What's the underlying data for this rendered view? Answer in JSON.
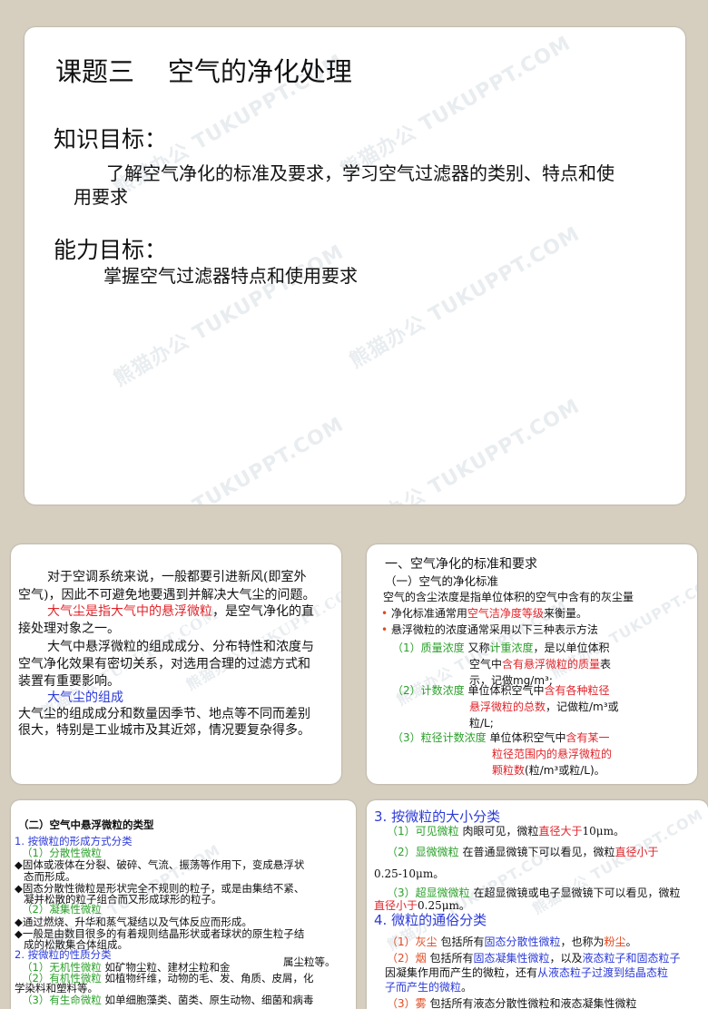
{
  "s1": {
    "title": "课题三    空气的净化处理",
    "knowledge_heading": "知识目标：",
    "knowledge_line1": "了解空气净化的标准及要求，学习空气过滤器的类别、特点和使",
    "knowledge_line2": "用要求",
    "ability_heading": "能力目标：",
    "ability_text": "掌握空气过滤器特点和使用要求"
  },
  "watermark": "熊猫办公 TUKUPPT.COM",
  "s2": {
    "l1": "对于空调系统来说，一般都要引进新风(即室外",
    "l2": "空气)，因此不可避免地要遇到并解决大气尘的问题。",
    "l3a": "大气尘是指大气中的悬浮微粒",
    "l3b": "，是空气净化的直",
    "l4": "接处理对象之一。",
    "l5": "大气中悬浮微粒的组成成分、分布特性和浓度与",
    "l6": "空气净化效果有密切关系，对选用合理的过滤方式和",
    "l7": "装置有重要影响。",
    "l8": "大气尘的组成",
    "l9": "大气尘的组成成分和数量因季节、地点等不同而差别",
    "l10": "很大，特别是工业城市及其近郊，情况要复杂得多。"
  },
  "s3": {
    "h1": "一、空气净化的标准和要求",
    "h2": "（一）空气的净化标准",
    "p1": "空气的含尘浓度是指单位体积的空气中含有的灰尘量",
    "b1a": "净化标准通常用",
    "b1b": "空气洁净度等级",
    "b1c": "来衡量。",
    "b2": "悬浮微粒的浓度通常采用以下三种表示方法",
    "i1a": "（1）质量浓度",
    "i1b": "又称",
    "i1c": "计重浓度",
    "i1d": "，是以单位体积",
    "i1e": "空气中",
    "i1f": "含有悬浮微粒的质量",
    "i1g": "表",
    "i1h": "示，记做mg/m³;",
    "i2a": "（2）计数浓度",
    "i2b": "单位体积空气中",
    "i2c": "含有各种粒径",
    "i2d": "悬浮微粒的总数",
    "i2e": "，记做粒/m³或",
    "i2f": "粒/L;",
    "i3a": "（3）粒径计数浓度",
    "i3b": "单位体积空气中",
    "i3c": "含有某一",
    "i3d": "粒径范围内的悬浮微粒的",
    "i3e": "颗粒数",
    "i3f": "(粒/m³或粒/L)。"
  },
  "s4": {
    "h": "（二）空气中悬浮微粒的类型",
    "a": "1. 按微粒的形成方式分类",
    "a1": "（1）分散性微粒",
    "a1t1": "◆固体或液体在分裂、破碎、气流、振荡等作用下，变成悬浮状",
    "a1t2": "态而形成。",
    "a1t3": "◆固态分散性微粒是形状完全不规则的粒子，或是由集结不紧、",
    "a1t4": "凝并松散的粒子组合而又形成球形的粒子。",
    "a2": "（2）凝集性微粒",
    "a2t1": "◆通过燃烧、升华和蒸气凝结以及气体反应而形成。",
    "a2t2": "◆一般是由数目很多的有着规则结晶形状或者球状的原生粒子结",
    "a2t3": "成的松散集合体组成。",
    "b": "2. 按微粒的性质分类",
    "b1a": "（1）无机性微粒",
    "b1b": "如矿物尘粒、建材尘粒和金",
    "b1c": "属尘粒等。",
    "b2a": "（2）有机性微粒",
    "b2b": "如植物纤维，动物的毛、发、角质、皮屑，化",
    "b2c": "学染料和塑料等。",
    "b3a": "（3）有生命微粒",
    "b3b": "如单细胞藻类、菌类、原生动物、细菌和病毒"
  },
  "s5": {
    "h3": "3. 按微粒的大小分类",
    "c1a": "（1）可见微粒",
    "c1b": "肉眼可见，微粒",
    "c1c": "直径大于",
    "c1d": "10μm。",
    "c2a": "（2）显微微粒",
    "c2b": "在普通显微镜下可以看见，微粒",
    "c2c": "直径小于",
    "c2d": "0.25-10μm。",
    "c3a": "（3）超显微微粒",
    "c3b": "在超显微镜或电子显微镜下可以看见，微粒",
    "c3c": "直径小于",
    "c3d": "0.25μm。",
    "h4": "4. 微粒的通俗分类",
    "d1a": "（1）灰尘",
    "d1b": "包括所有",
    "d1c": "固态分散性微粒",
    "d1d": "，也称为",
    "d1e": "粉尘",
    "d1f": "。",
    "d2a": "（2）烟",
    "d2b": "包括所有",
    "d2c": "固态凝集性微粒",
    "d2d": "，以及",
    "d2e": "液态粒子和固态粒子",
    "d2f": "因凝集作用而产生的微粒，还有",
    "d2g": "从液态粒子过渡到结晶态粒",
    "d2h": "子而产生的微粒",
    "d2i": "。",
    "d3a": "（3）雾",
    "d3b": "包括所有液态分散性微粒和液态凝集性微粒"
  }
}
